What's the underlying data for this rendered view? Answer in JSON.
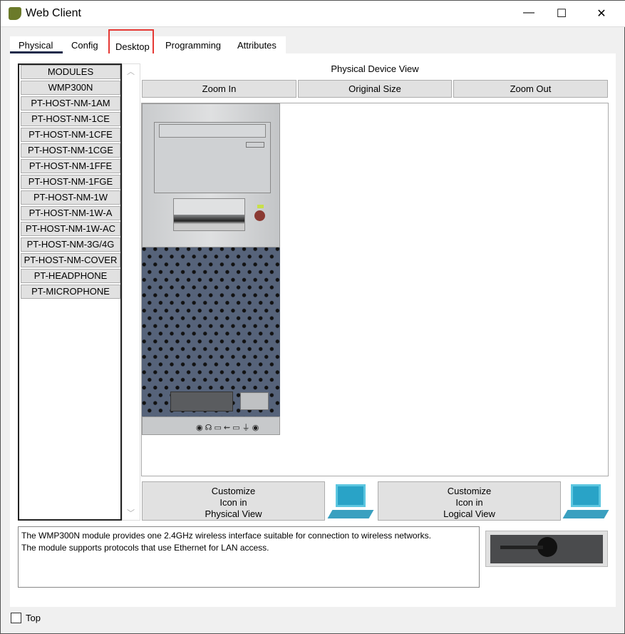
{
  "window": {
    "title": "Web Client",
    "minimize": "—",
    "maximize": "☐",
    "close": "✕"
  },
  "tabs": [
    {
      "label": "Physical",
      "active": true
    },
    {
      "label": "Config"
    },
    {
      "label": "Desktop",
      "highlighted": true
    },
    {
      "label": "Programming"
    },
    {
      "label": "Attributes"
    }
  ],
  "modules": [
    "MODULES",
    "WMP300N",
    "PT-HOST-NM-1AM",
    "PT-HOST-NM-1CE",
    "PT-HOST-NM-1CFE",
    "PT-HOST-NM-1CGE",
    "PT-HOST-NM-1FFE",
    "PT-HOST-NM-1FGE",
    "PT-HOST-NM-1W",
    "PT-HOST-NM-1W-A",
    "PT-HOST-NM-1W-AC",
    "PT-HOST-NM-3G/4G",
    "PT-HOST-NM-COVER",
    "PT-HEADPHONE",
    "PT-MICROPHONE"
  ],
  "view": {
    "title": "Physical Device View",
    "zoom_in": "Zoom In",
    "original_size": "Original Size",
    "zoom_out": "Zoom Out"
  },
  "customize_physical": [
    "Customize",
    "Icon in",
    "Physical View"
  ],
  "customize_logical": [
    "Customize",
    "Icon in",
    "Logical View"
  ],
  "description": [
    "The WMP300N module provides one 2.4GHz wireless interface suitable for connection to wireless networks.",
    "The module supports protocols that use Ethernet for LAN access."
  ],
  "footer": {
    "top_label": "Top",
    "top_checked": false
  },
  "colors": {
    "tab_underline": "#1b2a4a",
    "highlight_box": "#e53935",
    "case_grille": "#56637a"
  }
}
